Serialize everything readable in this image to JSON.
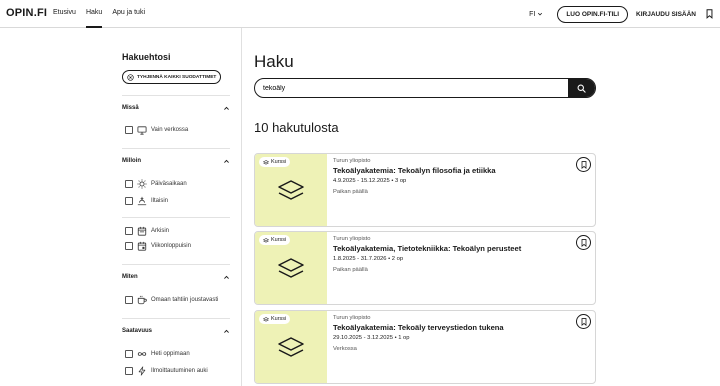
{
  "header": {
    "logo": "OPIN.FI",
    "nav": [
      "Etusivu",
      "Haku",
      "Apu ja tuki"
    ],
    "active_nav": "Haku",
    "language": "FI",
    "register_label": "LUO OPIN.FI-TILI",
    "login_label": "KIRJAUDU SISÄÄN"
  },
  "sidebar": {
    "title": "Hakuehtosi",
    "clear_label": "TYHJENNÄ KAIKKI SUODATTIMET",
    "sections": {
      "missa": {
        "title": "Missä",
        "options": [
          "Vain verkossa"
        ]
      },
      "milloin": {
        "title": "Milloin",
        "options": [
          "Päiväsaikaan",
          "Iltaisin",
          "Arkisin",
          "Viikonloppuisin"
        ]
      },
      "miten": {
        "title": "Miten",
        "options": [
          "Omaan tahtiin joustavasti"
        ]
      },
      "saatavuus": {
        "title": "Saatavuus",
        "options": [
          "Heti oppimaan",
          "Ilmoittautuminen auki"
        ]
      }
    }
  },
  "main": {
    "title": "Haku",
    "search_value": "tekoäly",
    "results_count_label": "10 hakutulosta",
    "results": [
      {
        "badge": "Kurssi",
        "university": "Turun yliopisto",
        "title": "Tekoälyakatemia: Tekoälyn filosofia ja etiikka",
        "meta": "4.9.2025 - 15.12.2025 • 3 op",
        "location": "Paikan päällä"
      },
      {
        "badge": "Kurssi",
        "university": "Turun yliopisto",
        "title": "Tekoälyakatemia, Tietotekniikka: Tekoälyn perusteet",
        "meta": "1.8.2025 - 31.7.2026 • 2 op",
        "location": "Paikan päällä"
      },
      {
        "badge": "Kurssi",
        "university": "Turun yliopisto",
        "title": "Tekoälyakatemia: Tekoäly terveystiedon tukena",
        "meta": "29.10.2025 - 3.12.2025 • 1 op",
        "location": "Verkossa"
      }
    ]
  },
  "colors": {
    "accent_dark": "#1a1a1a",
    "thumb_bg": "#eef2b6"
  }
}
